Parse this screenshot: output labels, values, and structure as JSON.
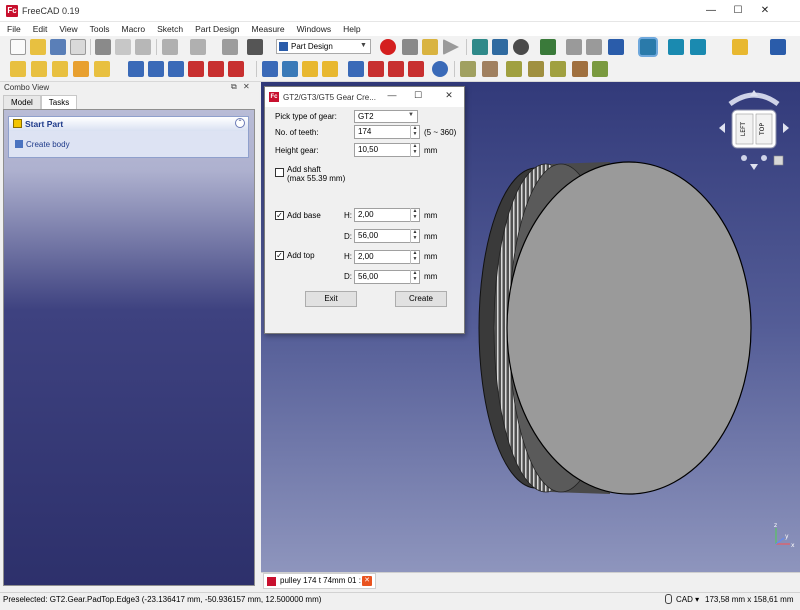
{
  "app": {
    "title": "FreeCAD 0.19",
    "logo": "Fc",
    "minimize": "—",
    "maximize": "☐",
    "close": "✕"
  },
  "menu": [
    "File",
    "Edit",
    "View",
    "Tools",
    "Macro",
    "Sketch",
    "Part Design",
    "Measure",
    "Windows",
    "Help"
  ],
  "toolbar": {
    "workbench": "Part Design"
  },
  "combo_view": {
    "title": "Combo View",
    "float_icon": "⧉",
    "close_icon": "✕",
    "tabs": [
      "Model",
      "Tasks"
    ],
    "active_tab": "Tasks",
    "task_title": "Start Part",
    "collapse": "⌃",
    "create_body": "Create body"
  },
  "dialog": {
    "title": "GT2/GT3/GT5 Gear Cre...",
    "logo": "Fc",
    "minimize": "—",
    "maximize": "☐",
    "close": "✕",
    "gear_type_label": "Pick type of gear:",
    "gear_type_value": "GT2",
    "teeth_label": "No. of teeth:",
    "teeth_value": "174",
    "teeth_range": "(5 ~ 360)",
    "height_label": "Height gear:",
    "height_value": "10,50",
    "height_unit": "mm",
    "shaft_label": "Add shaft",
    "shaft_max": "(max 55.39 mm)",
    "shaft_checked": false,
    "base_label": "Add base",
    "base_checked": true,
    "base_h_label": "H:",
    "base_h_value": "2,00",
    "base_d_label": "D:",
    "base_d_value": "56,00",
    "top_label": "Add top",
    "top_checked": true,
    "top_h_label": "H:",
    "top_h_value": "2,00",
    "top_d_label": "D:",
    "top_d_value": "56,00",
    "unit": "mm",
    "exit_button": "Exit",
    "create_button": "Create"
  },
  "navcube": {
    "left": "LEFT",
    "top": "TOP"
  },
  "document_tab": {
    "label": "pulley 174 t 74mm 01 : 1",
    "close": "✕"
  },
  "status": {
    "preselected": "Preselected: GT2.Gear.PadTop.Edge3 (-23.136417 mm, -50.936157 mm, 12.500000 mm)",
    "nav_style": "CAD ▾",
    "dimensions": "173,58 mm x 158,61 mm"
  },
  "axis": {
    "z": "z",
    "y": "y",
    "x": "x"
  },
  "colors": {
    "logo_red": "#c8102e",
    "view_top": "#323a7a",
    "view_bottom": "#8e95bd",
    "gear_face": "#9a9a9a"
  }
}
